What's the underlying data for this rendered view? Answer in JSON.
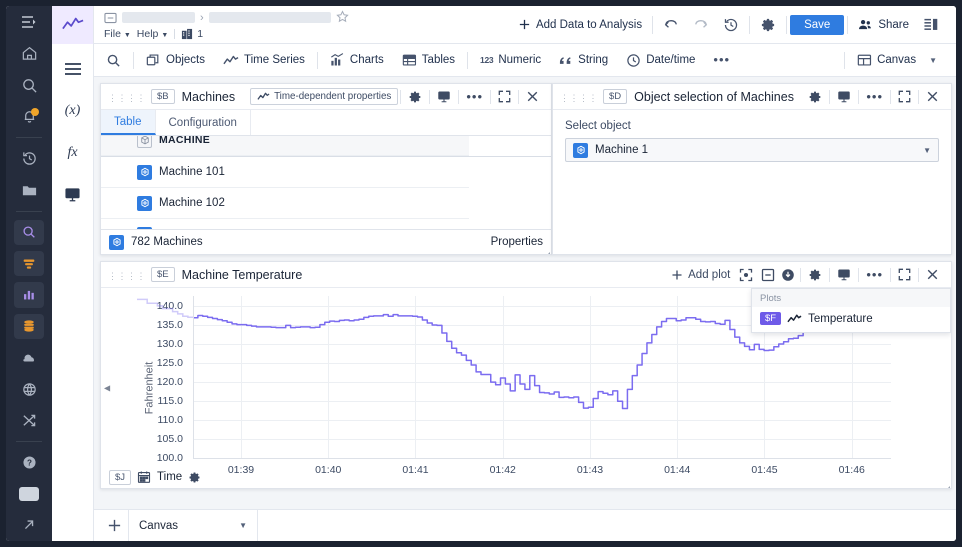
{
  "header": {
    "menu": [
      "File",
      "Help"
    ],
    "version_count": "1",
    "add_data_label": "Add Data to Analysis",
    "save_label": "Save",
    "share_label": "Share",
    "accent_blue": "#2f7ce0",
    "icons": [
      "collapse-left-icon",
      "notebook-icon",
      "star-icon",
      "undo-icon",
      "redo-icon",
      "history-icon",
      "gear-icon",
      "share-icon",
      "layout-panel-icon"
    ]
  },
  "toolstrip": {
    "items": [
      {
        "label": "Objects",
        "icon": "objects-icon"
      },
      {
        "label": "Time Series",
        "icon": "timeseries-icon"
      },
      {
        "label": "Charts",
        "icon": "charts-icon"
      },
      {
        "label": "Tables",
        "icon": "tables-icon"
      },
      {
        "label": "Numeric",
        "icon": "numeric-123-icon"
      },
      {
        "label": "String",
        "icon": "quote-icon"
      },
      {
        "label": "Date/time",
        "icon": "clock-icon"
      }
    ],
    "overflow": "•••",
    "canvas_selector": "Canvas"
  },
  "rail": {
    "items": [
      "home-icon",
      "search-icon",
      "notifications-icon",
      "history-icon",
      "folder-icon",
      "object-explorer-icon",
      "filter-icon",
      "chart-icon",
      "database-icon",
      "cloud-icon",
      "globe-icon",
      "shuffle-icon",
      "help-icon",
      "chat-icon",
      "external-link-icon"
    ]
  },
  "rail2": {
    "items": [
      "menu-icon",
      "variable-icon",
      "function-icon",
      "presentation-icon"
    ],
    "logo": "line-chart-logo"
  },
  "panels": {
    "machines": {
      "var": "$B",
      "title": "Machines",
      "tdp_button": "Time-dependent properties",
      "tabs": [
        {
          "label": "Table",
          "active": true
        },
        {
          "label": "Configuration",
          "active": false
        }
      ],
      "column_header": "MACHINE",
      "rows": [
        "Machine 101",
        "Machine 102"
      ],
      "footer_count": "782 Machines",
      "footer_right": "Properties"
    },
    "object_selection": {
      "var": "$D",
      "title": "Object selection of Machines",
      "select_label": "Select object",
      "selected_value": "Machine 1"
    },
    "chart": {
      "var": "$E",
      "title": "Machine Temperature",
      "add_plot_label": "Add plot",
      "plots_popover": {
        "header": "Plots",
        "entries": [
          {
            "var": "$F",
            "label": "Temperature",
            "color": "#6e5ae8"
          }
        ]
      },
      "xbar": {
        "var": "$J",
        "label": "Time"
      }
    }
  },
  "bottom": {
    "tab_label": "Canvas"
  },
  "chart_data": {
    "type": "line",
    "title": "Machine Temperature",
    "xlabel": "Time",
    "ylabel": "Fahrenheit",
    "ylim": [
      100.0,
      142.5
    ],
    "yticks": [
      140.0,
      135.0,
      130.0,
      125.0,
      120.0,
      115.0,
      110.0,
      105.0,
      100.0
    ],
    "ytick_labels": [
      "140.0",
      "135.0",
      "130.0",
      "125.0",
      "120.0",
      "115.0",
      "110.0",
      "105.0",
      "100.0"
    ],
    "xticks": [
      "01:39",
      "01:40",
      "01:41",
      "01:42",
      "01:43",
      "01:44",
      "01:45",
      "01:46"
    ],
    "xlim": [
      "01:38.6",
      "01:46.4"
    ],
    "grid": true,
    "legend": {
      "position": "top-right",
      "entries": [
        "Temperature"
      ]
    },
    "series": [
      {
        "name": "Temperature",
        "color": "#7b6cf0",
        "step": true,
        "values": [
          136.8,
          137.4,
          137.2,
          136.9,
          136.6,
          136.3,
          136.0,
          135.6,
          135.2,
          135.0,
          135.0,
          134.8,
          134.6,
          134.4,
          134.4,
          134.4,
          134.3,
          134.2,
          134.2,
          134.8,
          134.2,
          134.3,
          134.4,
          134.4,
          134.2,
          134.3,
          135.0,
          135.6,
          135.9,
          135.8,
          136.1,
          136.2,
          136.0,
          136.2,
          136.4,
          136.9,
          137.2,
          137.3,
          137.3,
          137.6,
          137.2,
          137.6,
          137.3,
          137.3,
          137.3,
          137.2,
          137.0,
          136.2,
          135.4,
          134.9,
          134.8,
          132.8,
          130.6,
          128.8,
          127.6,
          127.0,
          125.6,
          124.4,
          122.6,
          121.9,
          121.9,
          119.9,
          119.2,
          121.0,
          119.4,
          117.6,
          121.8,
          119.4,
          118.0,
          121.6,
          119.0,
          117.2,
          117.1,
          116.8,
          117.3,
          115.9,
          116.0,
          115.8,
          116.0,
          114.6,
          113.1,
          113.3,
          115.6,
          117.4,
          117.0,
          116.6,
          117.6,
          114.9,
          113.0,
          118.0,
          121.6,
          124.4,
          127.4,
          130.2,
          132.4,
          134.4,
          135.8,
          136.6,
          136.6,
          136.0,
          136.2,
          136.8,
          136.8,
          136.4,
          135.8,
          135.7,
          135.8,
          135.3,
          135.1,
          136.1,
          133.7,
          131.7,
          130.2,
          129.3,
          128.4,
          129.8,
          128.5,
          128.2,
          128.3,
          129.2,
          129.9,
          130.5,
          131.3,
          131.4,
          132.1,
          133.1,
          134.3,
          134.4,
          134.4,
          134.5,
          133.6,
          134.3,
          135.0,
          134.8,
          134.2,
          133.4,
          133.2,
          133.1,
          133.6,
          133.5,
          133.5,
          133.5,
          133.5,
          133.5
        ]
      }
    ]
  }
}
